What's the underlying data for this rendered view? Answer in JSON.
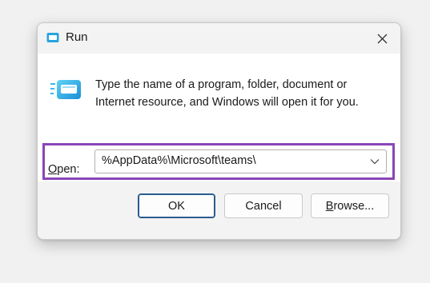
{
  "window": {
    "title": "Run",
    "close_icon": "close-icon"
  },
  "content": {
    "description": "Type the name of a program, folder, document or Internet resource, and Windows will open it for you.",
    "open_label_accesskey": "O",
    "open_label_rest": "pen:",
    "open_value": "%AppData%\\Microsoft\\teams\\",
    "highlight_color": "#8a45b8"
  },
  "buttons": {
    "ok": "OK",
    "cancel": "Cancel",
    "browse_accesskey": "B",
    "browse_rest": "rowse..."
  }
}
